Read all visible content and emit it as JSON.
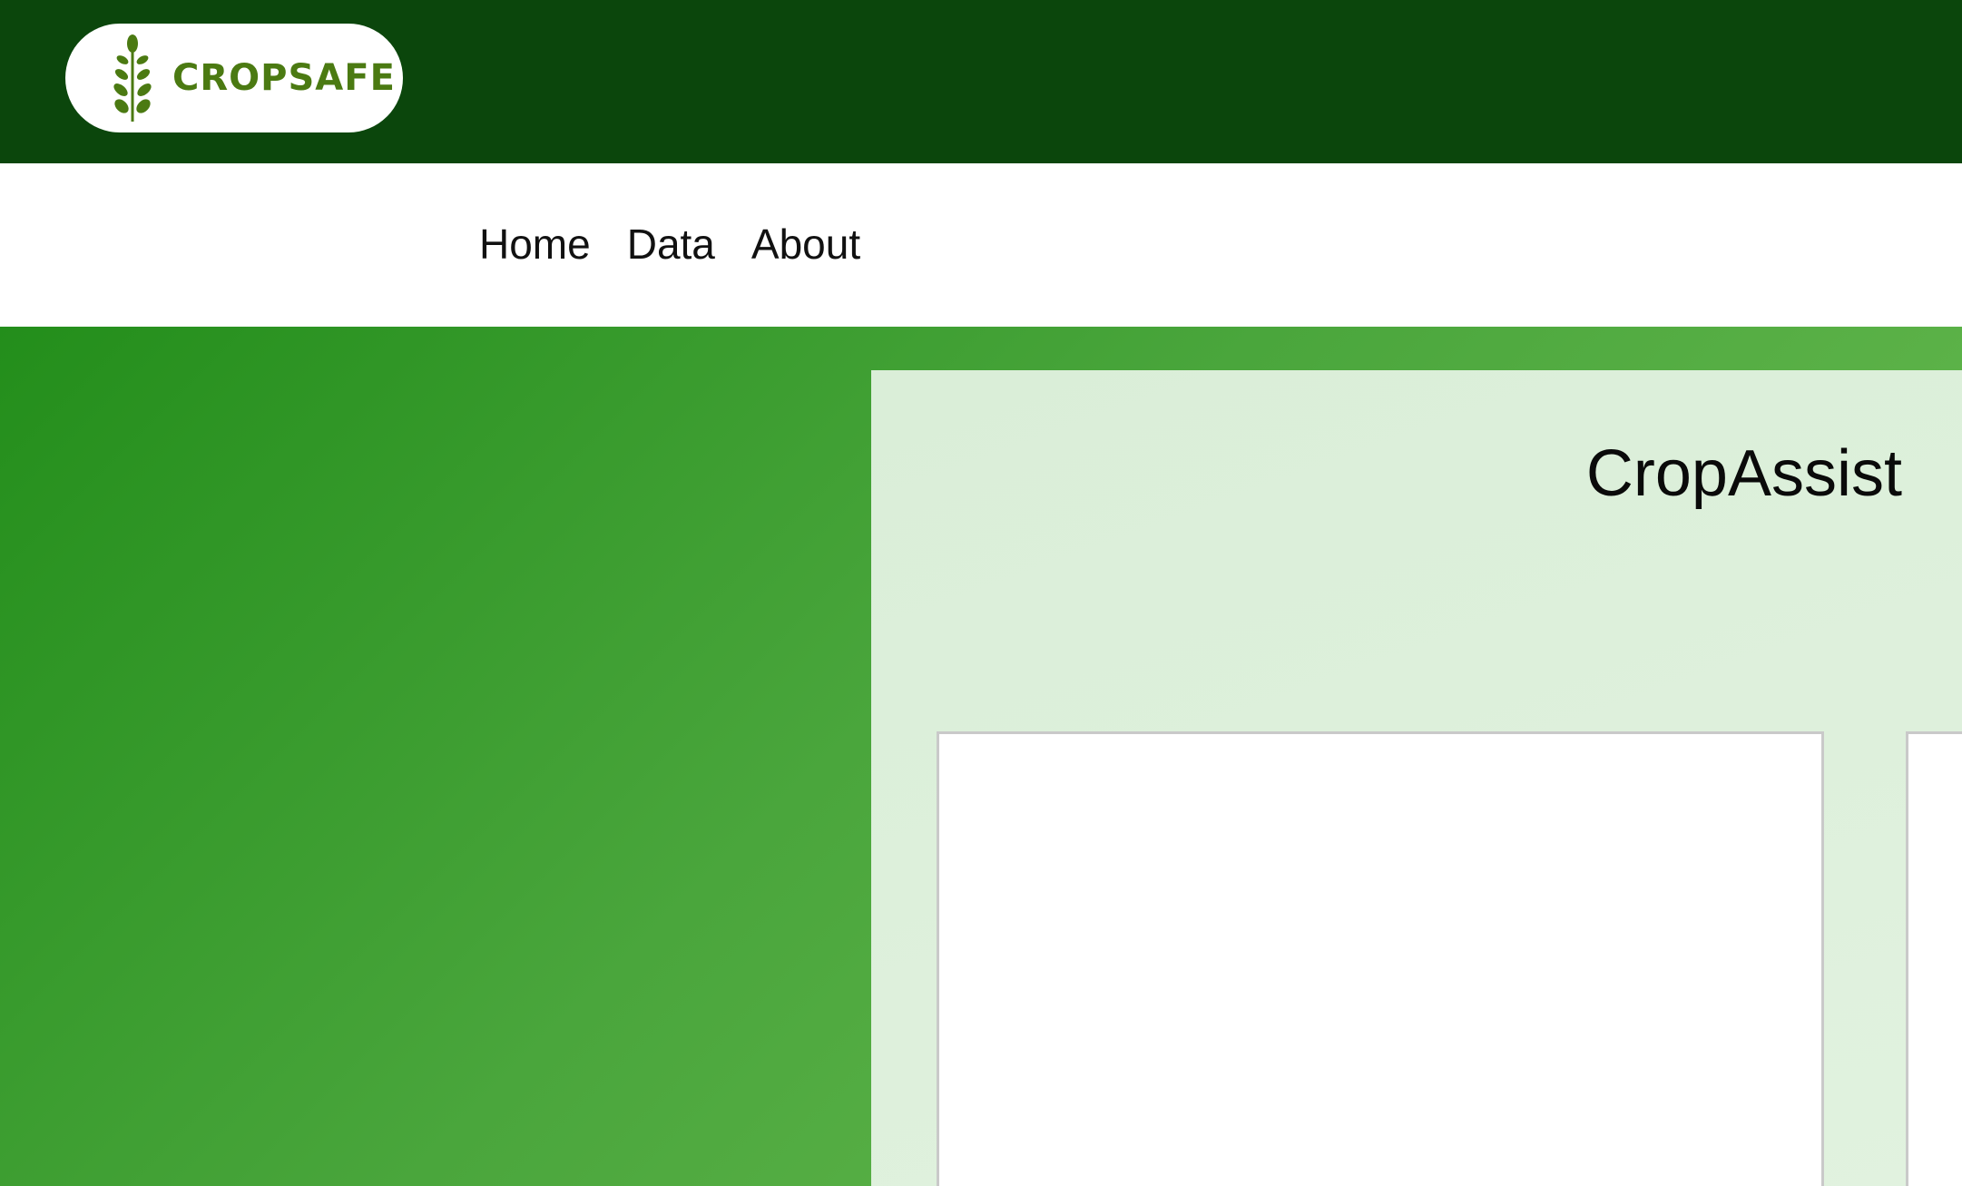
{
  "brand": {
    "name": "CROPSAFE",
    "logo_icon": "wheat-icon",
    "color_primary": "#4b7a12",
    "color_header": "#0b460c"
  },
  "nav": {
    "items": [
      {
        "label": "Home"
      },
      {
        "label": "Data"
      },
      {
        "label": "About"
      }
    ]
  },
  "main": {
    "title": "CropAssist"
  }
}
